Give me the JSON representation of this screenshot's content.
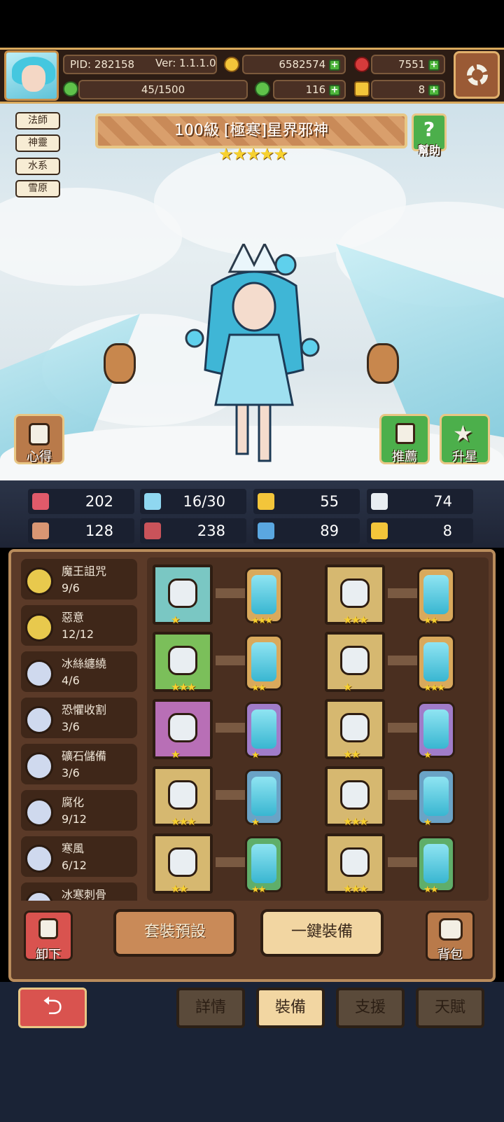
{
  "hud": {
    "pid": "PID: 282158",
    "version": "Ver: 1.1.1.0",
    "gold": "6582574",
    "gems": "7551",
    "energy": "45/1500",
    "clover": "116",
    "keys": "8",
    "plus": "+"
  },
  "tags": [
    "法師",
    "神靈",
    "水系",
    "雪原"
  ],
  "hero": {
    "title": "100級 [極寒]星界邪神",
    "stars": "★★★★★",
    "help_label": "幫助"
  },
  "side_buttons": {
    "insight": "心得",
    "recommend": "推薦",
    "star_up": "升星"
  },
  "stats": [
    {
      "icon": "heart-icon",
      "value": "202",
      "color": "#e05a6a"
    },
    {
      "icon": "water-drop-icon",
      "value": "16/30",
      "color": "#8fd7f0"
    },
    {
      "icon": "shield-icon",
      "value": "55",
      "color": "#f3c53a"
    },
    {
      "icon": "wing-icon",
      "value": "74",
      "color": "#e9eef2"
    },
    {
      "icon": "fist-icon",
      "value": "128",
      "color": "#d99673"
    },
    {
      "icon": "spellbook-icon",
      "value": "238",
      "color": "#c9535a"
    },
    {
      "icon": "boot-icon",
      "value": "89",
      "color": "#5aa7e0"
    },
    {
      "icon": "magnet-icon",
      "value": "8",
      "color": "#f3c53a"
    }
  ],
  "skills": [
    {
      "name": "魔王詛咒",
      "value": "9/6",
      "color": "#e8c94d"
    },
    {
      "name": "惡意",
      "value": "12/12",
      "color": "#e8c94d"
    },
    {
      "name": "冰絲纏繞",
      "value": "4/6",
      "color": "#cfd9ee"
    },
    {
      "name": "恐懼收割",
      "value": "3/6",
      "color": "#cfd9ee"
    },
    {
      "name": "礦石儲備",
      "value": "3/6",
      "color": "#cfd9ee"
    },
    {
      "name": "腐化",
      "value": "9/12",
      "color": "#cfd9ee"
    },
    {
      "name": "寒風",
      "value": "6/12",
      "color": "#cfd9ee"
    },
    {
      "name": "冰寒刺骨",
      "value": "",
      "color": "#cfd9ee"
    }
  ],
  "equipment": [
    {
      "item": "staff-icon",
      "bg": "#7ac7c3",
      "stars": "★",
      "gem_stars": "★★★",
      "gem_border": "#d9a95c"
    },
    {
      "item": "horned-helmet-icon",
      "bg": "#d6b870",
      "stars": "★★★",
      "gem_stars": "★★",
      "gem_border": "#d9a95c"
    },
    {
      "item": "pouch-icon",
      "bg": "#7bbf5a",
      "stars": "★★★",
      "gem_stars": "★★",
      "gem_border": "#d9a95c"
    },
    {
      "item": "ice-cape-icon",
      "bg": "#d6b870",
      "stars": "★",
      "gem_stars": "★★★",
      "gem_border": "#d9a95c"
    },
    {
      "item": "necklace-icon",
      "bg": "#b86fb6",
      "stars": "★",
      "gem_stars": "★",
      "gem_border": "#a07cc9"
    },
    {
      "item": "ice-shard-icon",
      "bg": "#d6b870",
      "stars": "★★",
      "gem_stars": "★",
      "gem_border": "#a07cc9"
    },
    {
      "item": "ore-armor-icon",
      "bg": "#d6b870",
      "stars": "★★★",
      "gem_stars": "★",
      "gem_border": "#6aa3c6"
    },
    {
      "item": "dark-chestplate-icon",
      "bg": "#d6b870",
      "stars": "★★★",
      "gem_stars": "★",
      "gem_border": "#6aa3c6"
    },
    {
      "item": "ice-ring-icon",
      "bg": "#d6b870",
      "stars": "★★",
      "gem_stars": "★★",
      "gem_border": "#5fae6a"
    },
    {
      "item": "armored-boots-icon",
      "bg": "#d6b870",
      "stars": "★★★",
      "gem_stars": "★★",
      "gem_border": "#5fae6a"
    }
  ],
  "actions": {
    "unequip": "卸下",
    "set_preset": "套裝預設",
    "equip_all": "一鍵裝備",
    "backpack": "背包"
  },
  "tabs": [
    "詳情",
    "裝備",
    "支援",
    "天賦"
  ],
  "back_symbol": "⮌"
}
